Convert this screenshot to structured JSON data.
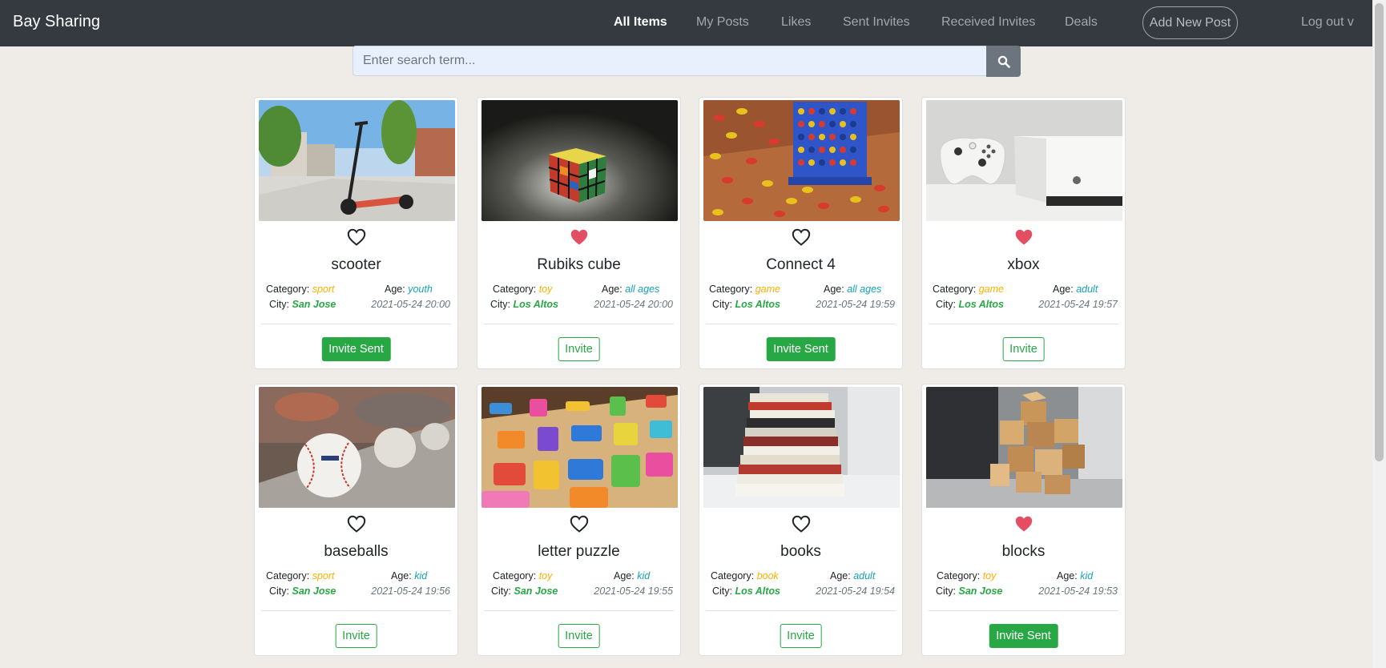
{
  "navbar": {
    "brand": "Bay Sharing",
    "links": [
      "All Items",
      "My Posts",
      "Likes",
      "Sent Invites",
      "Received Invites",
      "Deals"
    ],
    "add_post": "Add New Post",
    "logout": "Log out v"
  },
  "search": {
    "placeholder": "Enter search term..."
  },
  "labels": {
    "category": "Category:",
    "age": "Age:",
    "city": "City:"
  },
  "colors": {
    "category": "#ffb000",
    "age": "#17a2b8",
    "city": "#28a745",
    "heart_liked": "#e34e63",
    "button": "#28a745"
  },
  "items": [
    {
      "title": "scooter",
      "category": "sport",
      "age": "youth",
      "city": "San Jose",
      "date": "2021-05-24 20:00",
      "liked": false,
      "button": "Invite Sent",
      "image_icon": "scooter-image"
    },
    {
      "title": "Rubiks cube",
      "category": "toy",
      "age": "all ages",
      "city": "Los Altos",
      "date": "2021-05-24 20:00",
      "liked": true,
      "button": "Invite",
      "image_icon": "rubiks-cube-image"
    },
    {
      "title": "Connect 4",
      "category": "game",
      "age": "all ages",
      "city": "Los Altos",
      "date": "2021-05-24 19:59",
      "liked": false,
      "button": "Invite Sent",
      "image_icon": "connect-four-image"
    },
    {
      "title": "xbox",
      "category": "game",
      "age": "adult",
      "city": "Los Altos",
      "date": "2021-05-24 19:57",
      "liked": true,
      "button": "Invite",
      "image_icon": "xbox-image"
    },
    {
      "title": "baseballs",
      "category": "sport",
      "age": "kid",
      "city": "San Jose",
      "date": "2021-05-24 19:56",
      "liked": false,
      "button": "Invite",
      "image_icon": "baseballs-image"
    },
    {
      "title": "letter puzzle",
      "category": "toy",
      "age": "kid",
      "city": "San Jose",
      "date": "2021-05-24 19:55",
      "liked": false,
      "button": "Invite",
      "image_icon": "letter-puzzle-image"
    },
    {
      "title": "books",
      "category": "book",
      "age": "adult",
      "city": "Los Altos",
      "date": "2021-05-24 19:54",
      "liked": false,
      "button": "Invite",
      "image_icon": "books-image"
    },
    {
      "title": "blocks",
      "category": "toy",
      "age": "kid",
      "city": "San Jose",
      "date": "2021-05-24 19:53",
      "liked": true,
      "button": "Invite Sent",
      "image_icon": "wooden-blocks-image"
    }
  ]
}
